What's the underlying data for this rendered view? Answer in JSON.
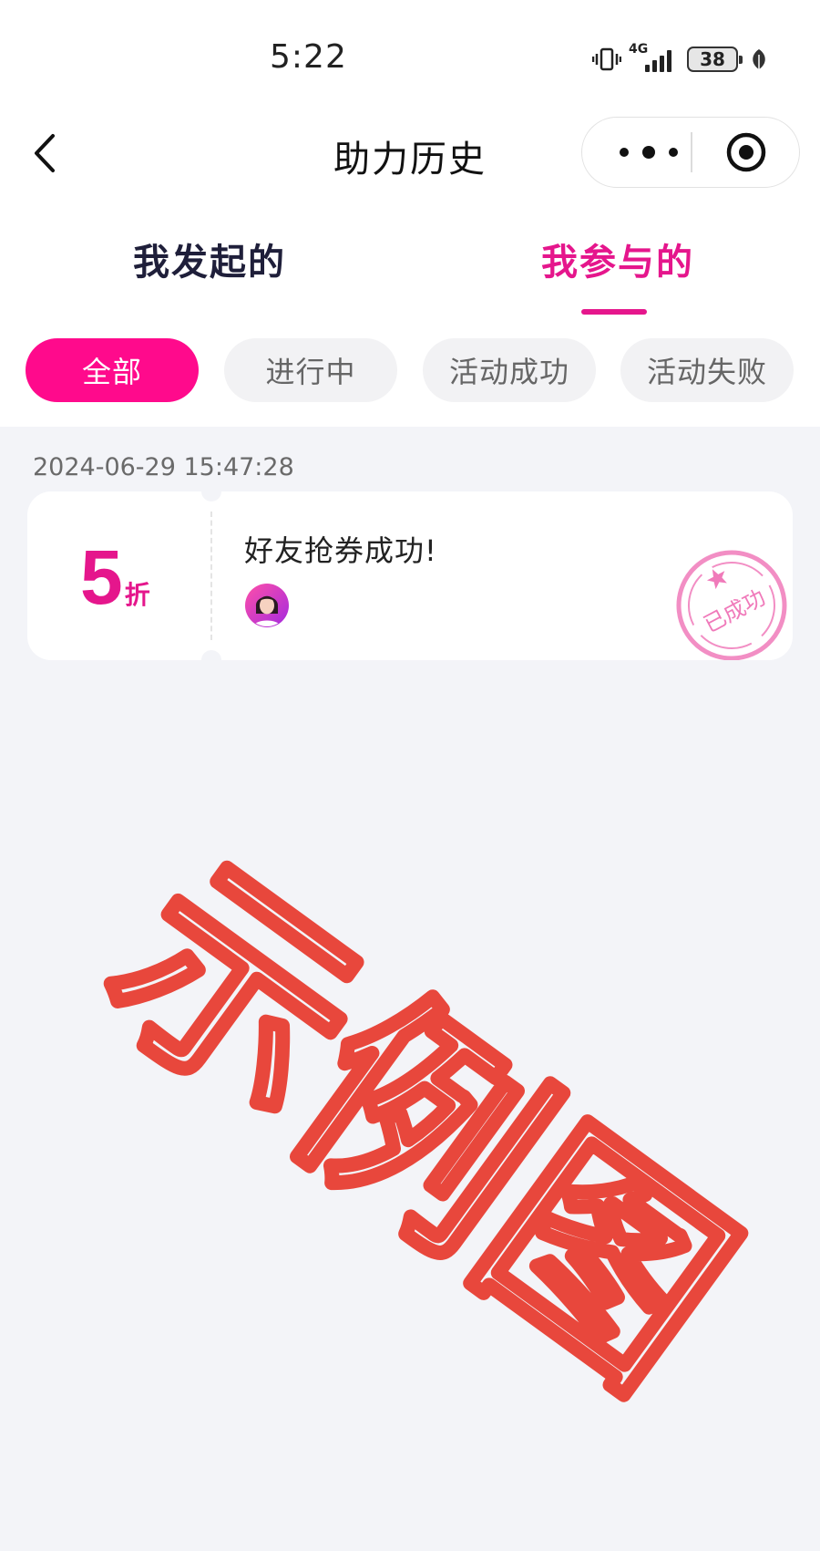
{
  "status_bar": {
    "time": "5:22",
    "network": "4G",
    "battery": "38"
  },
  "nav": {
    "title": "助力历史"
  },
  "tabs": [
    {
      "label": "我发起的",
      "active": false
    },
    {
      "label": "我参与的",
      "active": true
    }
  ],
  "filters": [
    {
      "label": "全部",
      "active": true
    },
    {
      "label": "进行中",
      "active": false
    },
    {
      "label": "活动成功",
      "active": false
    },
    {
      "label": "活动失败",
      "active": false
    }
  ],
  "records": [
    {
      "datetime": "2024-06-29 15:47:28",
      "discount_value": "5",
      "discount_unit": "折",
      "title": "好友抢券成功!",
      "stamp": "已成功"
    }
  ],
  "watermark": "示例图",
  "colors": {
    "accent": "#e5168c",
    "chip_active": "#ff0a8c",
    "stamp": "#f07aba",
    "watermark": "#e8473c",
    "background": "#f3f4f8"
  },
  "icons": [
    "back-icon",
    "more-icon",
    "close-capsule-icon",
    "vibrate-icon",
    "signal-icon",
    "battery-icon",
    "leaf-icon",
    "avatar-icon"
  ]
}
